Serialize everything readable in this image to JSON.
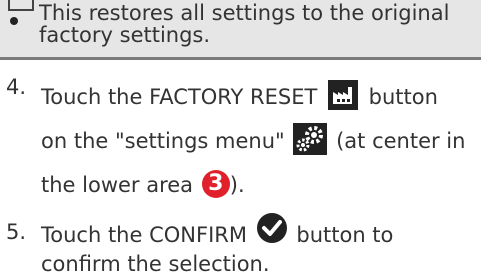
{
  "note": {
    "text": "This restores all settings to the original factory settings."
  },
  "steps": [
    {
      "number": "4.",
      "line1_a": "Touch the FACTORY RESET",
      "line1_b": "button",
      "line2_a": "on the \"settings menu\"",
      "line2_b": "(at center in",
      "line3_a": "the lower area",
      "callout": "3",
      "line3_b": ")."
    },
    {
      "number": "5.",
      "text_a": "Touch the CONFIRM",
      "text_b": "button to confirm the selection."
    }
  ],
  "icons": {
    "factory": "factory-reset-icon",
    "settings": "gear-icon",
    "confirm": "check-circle-icon"
  }
}
